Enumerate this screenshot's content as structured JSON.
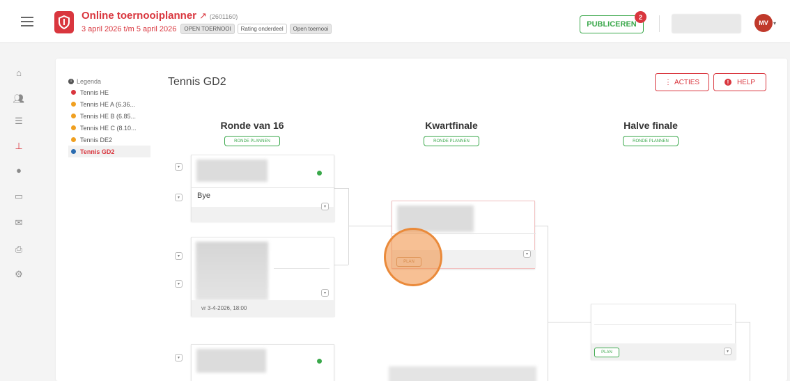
{
  "top_banner_text": "",
  "header": {
    "title": "Online toernooiplanner",
    "tournament_id": "(2601160)",
    "dates": "3 april 2026 t/m 5 april 2026",
    "tags": [
      "OPEN TOERNOOI",
      "Rating onderdeel",
      "Open toernooi"
    ],
    "publish_label": "PUBLICEREN",
    "publish_badge": "2",
    "avatar_initials": "MV"
  },
  "rail_icons": [
    "home-icon",
    "users-icon",
    "list-icon",
    "bracket-icon",
    "ball-icon",
    "monitor-icon",
    "mail-icon",
    "print-icon",
    "gear-icon"
  ],
  "legend": {
    "title": "Legenda",
    "items": [
      {
        "label": "Tennis HE",
        "color": "#d9363e"
      },
      {
        "label": "Tennis HE A (6.36...",
        "color": "#f0a020"
      },
      {
        "label": "Tennis HE B (6.85...",
        "color": "#f0a020"
      },
      {
        "label": "Tennis HE C (8.10...",
        "color": "#f0a020"
      },
      {
        "label": "Tennis DE2",
        "color": "#f0a020"
      },
      {
        "label": "Tennis GD2",
        "color": "#2b6cb0"
      }
    ]
  },
  "draw_title": "Tennis GD2",
  "actions_label": "ACTIES",
  "help_label": "HELP",
  "rounds": [
    {
      "title": "Ronde van 16",
      "plan_label": "RONDE PLANNEN"
    },
    {
      "title": "Kwartfinale",
      "plan_label": "RONDE PLANNEN"
    },
    {
      "title": "Halve finale",
      "plan_label": "RONDE PLANNEN"
    }
  ],
  "matches": {
    "r16_1_bye": "Bye",
    "r16_2_time": "vr 3-4-2026, 18:00",
    "plan_label": "PLAN"
  },
  "colors": {
    "brand": "#d9363e",
    "success": "#3aa84b",
    "highlight": "#ea8a3a"
  }
}
